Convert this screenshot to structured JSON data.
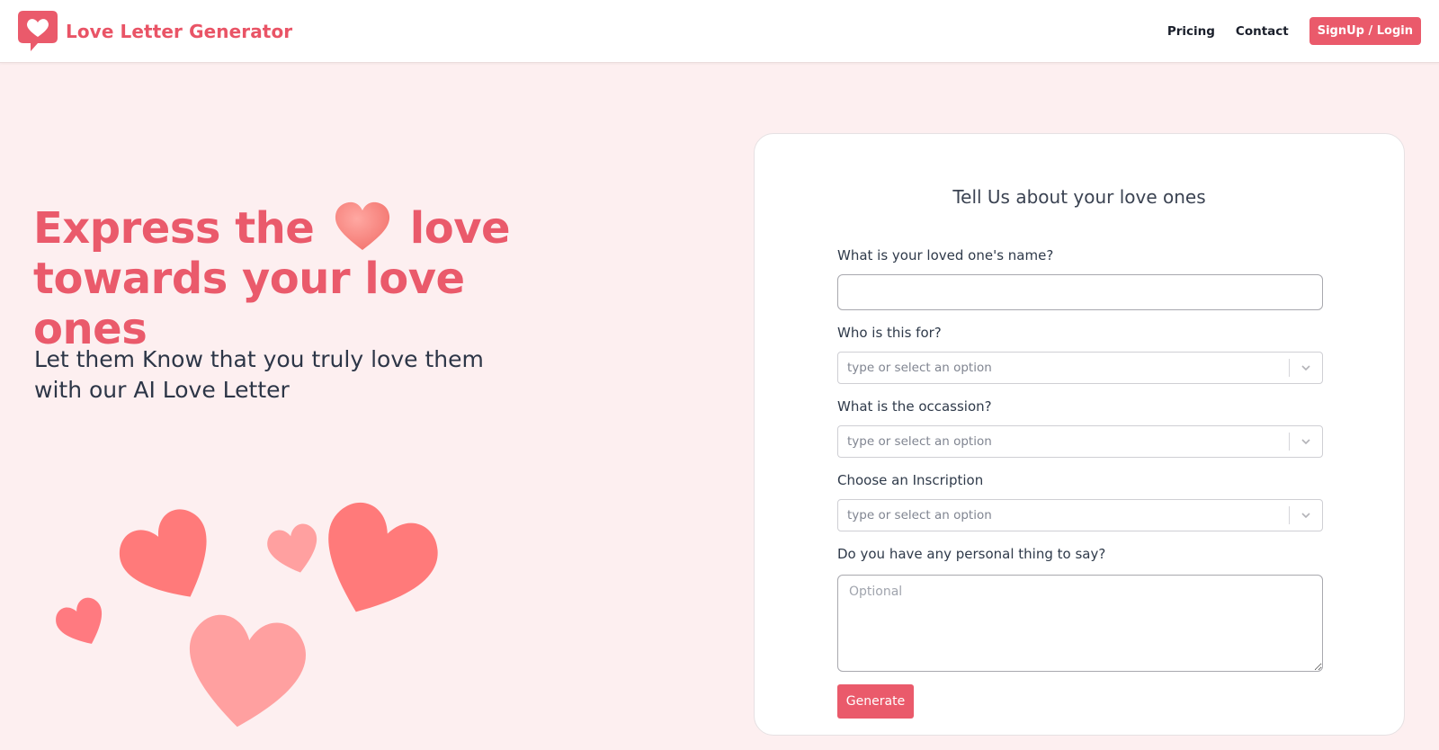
{
  "app": {
    "name": "Love Letter Generator"
  },
  "nav": {
    "pricing": "Pricing",
    "contact": "Contact",
    "signup": "SignUp / Login"
  },
  "hero": {
    "title_part1": "Express the",
    "title_part2": "love",
    "title_line2": "towards your love ones",
    "subtitle_line1": "Let them Know that you truly love them",
    "subtitle_line2": "with our AI Love Letter"
  },
  "form": {
    "title": "Tell Us about your love ones",
    "name_label": "What is your loved one's name?",
    "name_value": "",
    "who_label": "Who is this for?",
    "who_placeholder": "type or select an option",
    "occasion_label": "What is the occassion?",
    "occasion_placeholder": "type or select an option",
    "inscription_label": "Choose an Inscription",
    "inscription_placeholder": "type or select an option",
    "personal_label": "Do you have any personal thing to say?",
    "personal_placeholder": "Optional",
    "generate_label": "Generate"
  },
  "colors": {
    "accent": "#ea5a6b",
    "background": "#fdeff0",
    "heart_light": "#ff9e9e",
    "heart_dark": "#ff7a7a"
  },
  "icons": {
    "logo": "heart-speech-bubble-icon",
    "chevron": "chevron-down-icon",
    "inline_heart": "heart-icon"
  }
}
